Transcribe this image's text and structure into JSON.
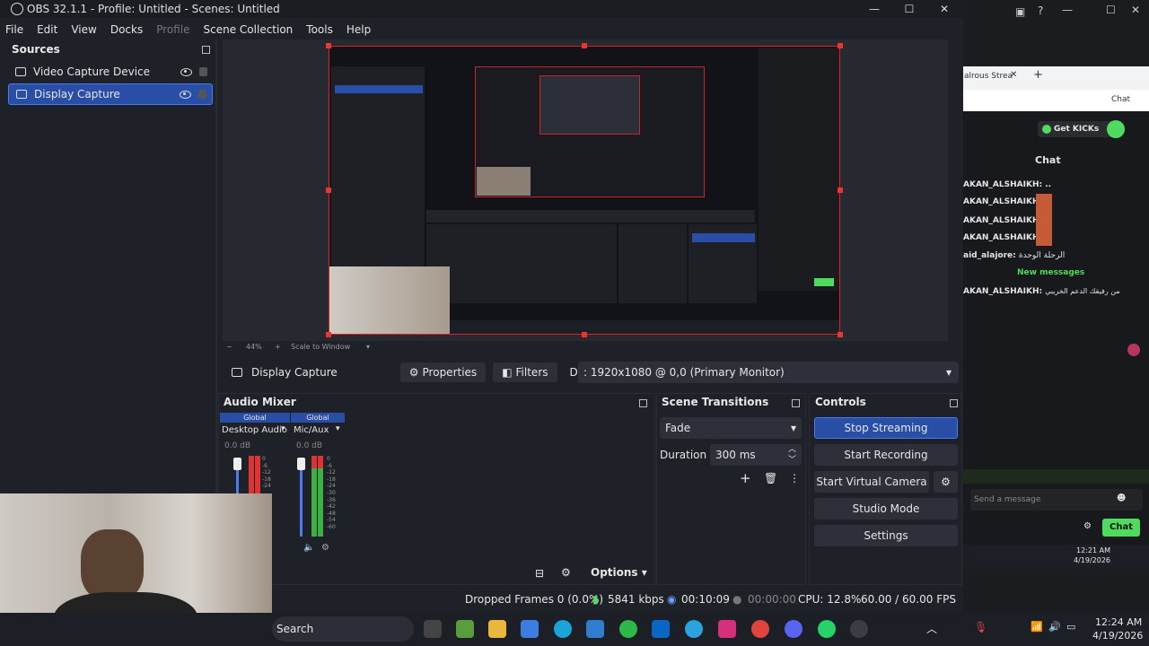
{
  "window": {
    "title": "OBS 32.1.1 - Profile: Untitled - Scenes: Untitled",
    "min": "—",
    "max": "☐",
    "close": "✕"
  },
  "menu": [
    "File",
    "Edit",
    "View",
    "Docks",
    "Profile",
    "Scene Collection",
    "Tools",
    "Help"
  ],
  "sources": {
    "title": "Sources",
    "items": [
      {
        "label": "Video Capture Device",
        "selected": false
      },
      {
        "label": "Display Capture",
        "selected": true
      }
    ]
  },
  "preview_bar": {
    "zoom": "44%",
    "scale_mode": "Scale to Window"
  },
  "properties_bar": {
    "source_name": "Display Capture",
    "properties": "Properties",
    "filters": "Filters",
    "display_label": "Display",
    "display_value": ": 1920x1080 @ 0,0 (Primary Monitor)"
  },
  "audio_mixer": {
    "title": "Audio Mixer",
    "channels": [
      {
        "global": "Global",
        "name": "Desktop Audio",
        "db": "0.0 dB",
        "ticks": [
          "0",
          "-6",
          "-12",
          "-18",
          "-24"
        ]
      },
      {
        "global": "Global",
        "name": "Mic/Aux",
        "db": "0.0 dB",
        "ticks": [
          "0",
          "-6",
          "-12",
          "-18",
          "-24",
          "-30",
          "-36",
          "-42",
          "-48",
          "-54",
          "-60"
        ]
      }
    ],
    "options": "Options"
  },
  "scene_transitions": {
    "title": "Scene Transitions",
    "transition": "Fade",
    "duration_label": "Duration",
    "duration_value": "300 ms"
  },
  "controls": {
    "title": "Controls",
    "stop_streaming": "Stop Streaming",
    "start_recording": "Start Recording",
    "start_virtual_camera": "Start Virtual Camera",
    "studio_mode": "Studio Mode",
    "settings": "Settings"
  },
  "status": {
    "dropped_frames": "Dropped Frames 0 (0.0%)",
    "bitrate": "5841 kbps",
    "stream_time": "00:10:09",
    "record_time": "00:00:00",
    "cpu": "CPU: 12.8%",
    "fps": "60.00 / 60.00 FPS"
  },
  "browser": {
    "tab_title": "alrous Strea",
    "get_kicks": "Get KICKs",
    "chat_title": "Chat",
    "messages": [
      {
        "user": "AKAN_ALSHAIKH:",
        "text": ".."
      },
      {
        "user": "AKAN_ALSHAIKH:",
        "text": ""
      },
      {
        "user": "AKAN_ALSHAIKH:",
        "text": ""
      },
      {
        "user": "AKAN_ALSHAIKH:",
        "text": ""
      },
      {
        "user": "aid_alajore:",
        "text": "الرحلة الوحدة"
      }
    ],
    "new_messages": "New messages",
    "last_message": {
      "user": "AKAN_ALSHAIKH:",
      "text": "من رفيقك الدعم الخريبي"
    },
    "send_placeholder": "Send a message",
    "chat_button": "Chat"
  },
  "taskbar": {
    "search": "Search",
    "time": "12:24 AM",
    "date": "4/19/2026",
    "right_time": "12:21 AM",
    "right_date": "4/19/2026"
  },
  "colors": {
    "accent_blue": "#284ea6",
    "record_red": "#dd2222",
    "kick_green": "#4fdc5e"
  }
}
